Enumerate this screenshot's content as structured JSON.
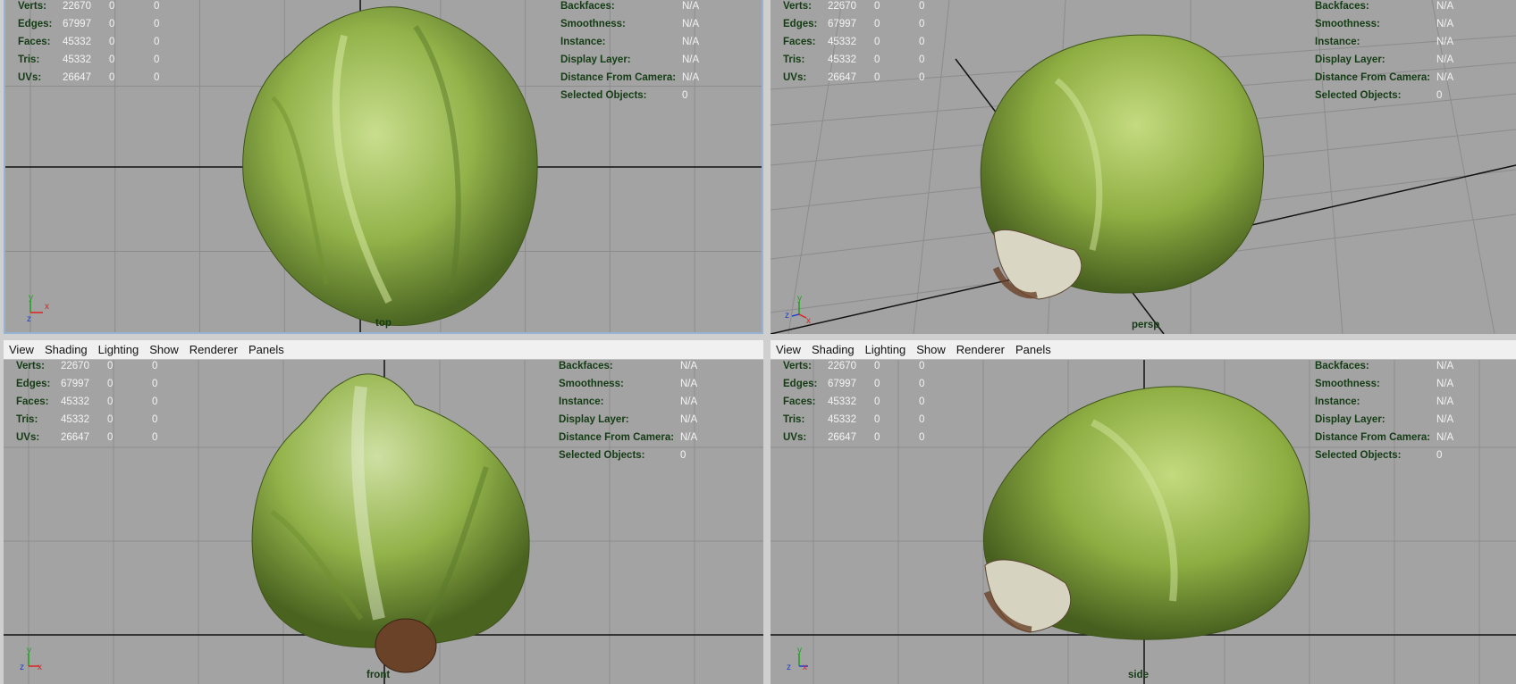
{
  "menu": [
    "View",
    "Shading",
    "Lighting",
    "Show",
    "Renderer",
    "Panels"
  ],
  "hud": {
    "left_rows": [
      {
        "label": "Verts:",
        "v1": "22670",
        "v2": "0",
        "v3": "0"
      },
      {
        "label": "Edges:",
        "v1": "67997",
        "v2": "0",
        "v3": "0"
      },
      {
        "label": "Faces:",
        "v1": "45332",
        "v2": "0",
        "v3": "0"
      },
      {
        "label": "Tris:",
        "v1": "45332",
        "v2": "0",
        "v3": "0"
      },
      {
        "label": "UVs:",
        "v1": "26647",
        "v2": "0",
        "v3": "0"
      }
    ],
    "right_rows": [
      {
        "label": "Backfaces:",
        "value": "N/A"
      },
      {
        "label": "Smoothness:",
        "value": "N/A"
      },
      {
        "label": "Instance:",
        "value": "N/A"
      },
      {
        "label": "Display Layer:",
        "value": "N/A"
      },
      {
        "label": "Distance From Camera:",
        "value": "N/A"
      },
      {
        "label": "Selected Objects:",
        "value": "0"
      }
    ]
  },
  "viewports": {
    "top": {
      "camera": "top",
      "axes": [
        "y",
        "x",
        "z"
      ]
    },
    "persp": {
      "camera": "persp",
      "axes": [
        "y",
        "z",
        "x"
      ]
    },
    "front": {
      "camera": "front",
      "axes": [
        "y",
        "z",
        "x"
      ]
    },
    "side": {
      "camera": "side",
      "axes": [
        "y",
        "z",
        "x"
      ]
    }
  },
  "colors": {
    "hud_label": "#143c14",
    "hud_value": "#f4f4f4",
    "viewport_bg": "#a3a3a3",
    "grid": "#8a8a8a",
    "axis_line": "#101010",
    "lettuce_light": "#c8dc8a",
    "lettuce_mid": "#8fb046",
    "lettuce_dark": "#4a6420",
    "stem": "#6a4228"
  }
}
